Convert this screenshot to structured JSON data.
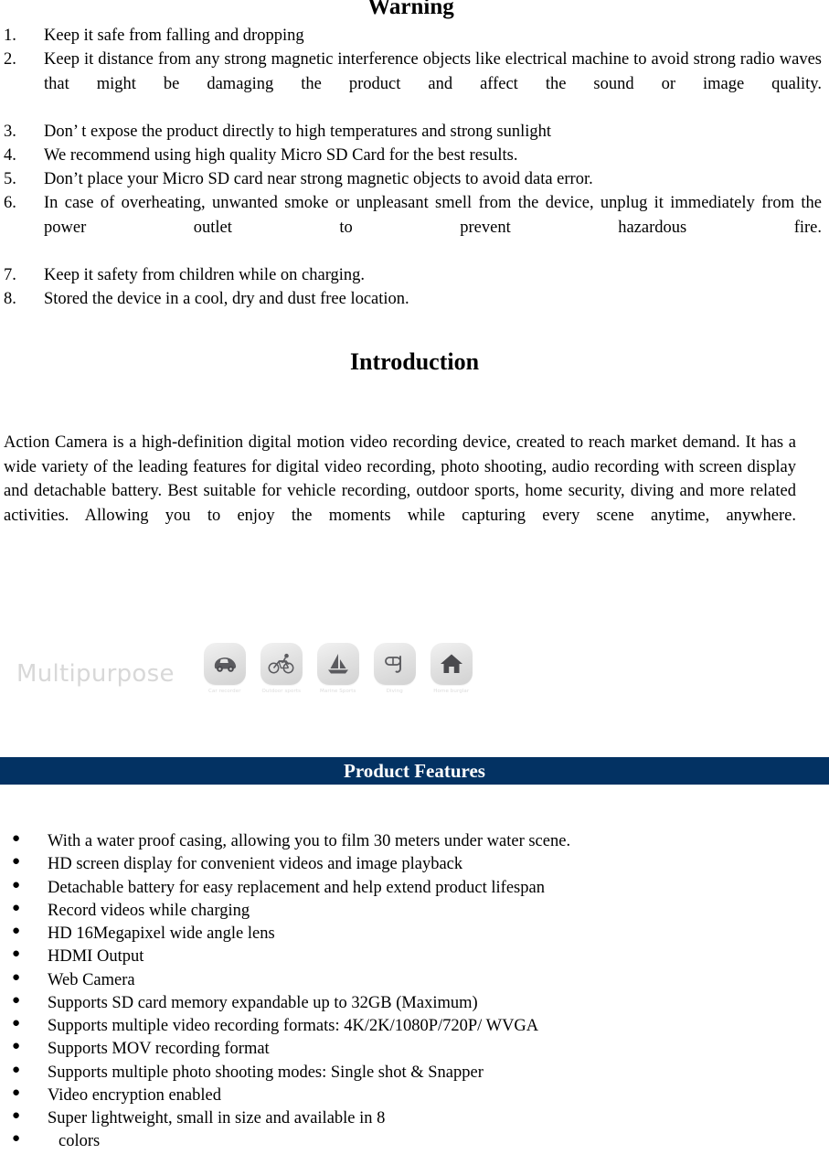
{
  "document": {
    "warning": {
      "heading": "Warning",
      "items": [
        {
          "number": "1.",
          "text": "Keep it safe from falling and dropping",
          "wrap": false
        },
        {
          "number": "2.",
          "text": "Keep it distance from any strong magnetic interference objects like electrical machine to avoid strong radio waves that might be damaging the product and affect the sound or image quality.",
          "wrap": true
        },
        {
          "number": "3.",
          "text": "Don’ t expose the product directly to high temperatures and strong sunlight",
          "wrap": false
        },
        {
          "number": "4.",
          "text": "We recommend using high quality Micro SD Card for the best results.",
          "wrap": false
        },
        {
          "number": "5.",
          "text": "Don’t place your Micro SD card near strong magnetic objects to avoid data error.",
          "wrap": false
        },
        {
          "number": "6.",
          "text": "In case of overheating, unwanted smoke or unpleasant smell from the device, unplug it immediately from the power outlet to prevent hazardous fire.",
          "wrap": true
        },
        {
          "number": "7.",
          "text": "Keep it safety from children while on charging.",
          "wrap": false
        },
        {
          "number": "8.",
          "text": "Stored the device in a cool, dry and dust free location.",
          "wrap": false
        }
      ]
    },
    "introduction": {
      "heading": "Introduction",
      "paragraph": "Action Camera is a high-definition digital motion video recording device, created to reach market demand. It has a wide variety of the leading features for digital video recording, photo shooting, audio recording with screen display and detachable battery. Best suitable for vehicle recording, outdoor sports, home security, diving and more related activities. Allowing you to enjoy the moments while capturing every scene anytime, anywhere."
    },
    "multipurpose": {
      "label": "Multipurpose",
      "icons": [
        {
          "icon": "car-icon",
          "caption": "Car recorder"
        },
        {
          "icon": "bicycle-icon",
          "caption": "Outdoor sports"
        },
        {
          "icon": "sailboat-icon",
          "caption": "Marine Sports"
        },
        {
          "icon": "snorkel-icon",
          "caption": "Diving"
        },
        {
          "icon": "house-icon",
          "caption": "Home burglar"
        }
      ]
    },
    "product_features": {
      "heading": "Product Features",
      "bullet_glyph": "●",
      "items": [
        {
          "text": "With a water proof casing, allowing you to film 30 meters under water scene.",
          "indent": false
        },
        {
          "text": "HD screen display for convenient videos and image playback",
          "indent": false
        },
        {
          "text": "Detachable battery for easy replacement and help extend product lifespan",
          "indent": false
        },
        {
          "text": "Record videos while charging",
          "indent": false
        },
        {
          "text": "HD 16Megapixel wide angle lens",
          "indent": false
        },
        {
          "text": "HDMI Output",
          "indent": false
        },
        {
          "text": "Web Camera",
          "indent": false
        },
        {
          "text": "Supports SD card memory expandable up to 32GB (Maximum)",
          "indent": false
        },
        {
          "text": "Supports multiple video recording formats: 4K/2K/1080P/720P/ WVGA",
          "indent": false
        },
        {
          "text": "Supports MOV recording format",
          "indent": false
        },
        {
          "text": "Supports multiple photo shooting modes: Single shot & Snapper",
          "indent": false
        },
        {
          "text": "Video encryption enabled",
          "indent": false
        },
        {
          "text": "Super lightweight, small in size and available in 8",
          "indent": false
        },
        {
          "text": "colors",
          "indent": true
        }
      ]
    },
    "colors": {
      "page_background": "#ffffff",
      "text": "#000000",
      "feature_bar_background": "#033263",
      "feature_bar_text": "#ffffff",
      "multipurpose_label": "#d8d8d8",
      "multipurpose_caption": "#dcdcdc"
    }
  }
}
